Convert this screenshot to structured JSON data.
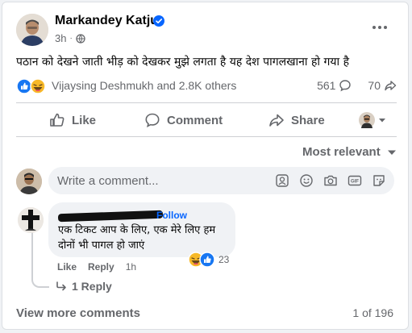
{
  "post": {
    "author_name": "Markandey Katju",
    "time": "3h",
    "text": "पठान को देखने जाती भीड़ को देखकर मुझे लगता है यह देश पागलखाना हो गया है",
    "reactions_names": "Vijaysing Deshmukh and 2.8K others",
    "comments_count": "561",
    "shares_count": "70"
  },
  "actions": {
    "like": "Like",
    "comment": "Comment",
    "share": "Share"
  },
  "sort": {
    "label": "Most relevant"
  },
  "composer": {
    "placeholder": "Write a comment..."
  },
  "comment": {
    "follow": "Follow",
    "text": "एक टिकट आप के लिए, एक मेरे लिए हम दोनों भी पागल हो जाएं",
    "like": "Like",
    "reply": "Reply",
    "time": "1h",
    "reaction_count": "23",
    "replies_label": "1 Reply"
  },
  "footer": {
    "view_more": "View more comments",
    "page_count": "1 of 196"
  },
  "colors": {
    "accent": "#0866ff",
    "text_secondary": "#65676b",
    "like_blue": "#1877f2",
    "haha_yellow": "#f7b928"
  },
  "icons": [
    "verified-badge-icon",
    "globe-icon",
    "more-dots-icon",
    "like-reaction-icon",
    "haha-reaction-icon",
    "comment-icon",
    "share-icon",
    "thumbs-up-icon",
    "chevron-down-icon",
    "avatar-sticker-icon",
    "emoji-icon",
    "camera-icon",
    "gif-icon",
    "sticker-icon",
    "reply-arrow-icon"
  ]
}
